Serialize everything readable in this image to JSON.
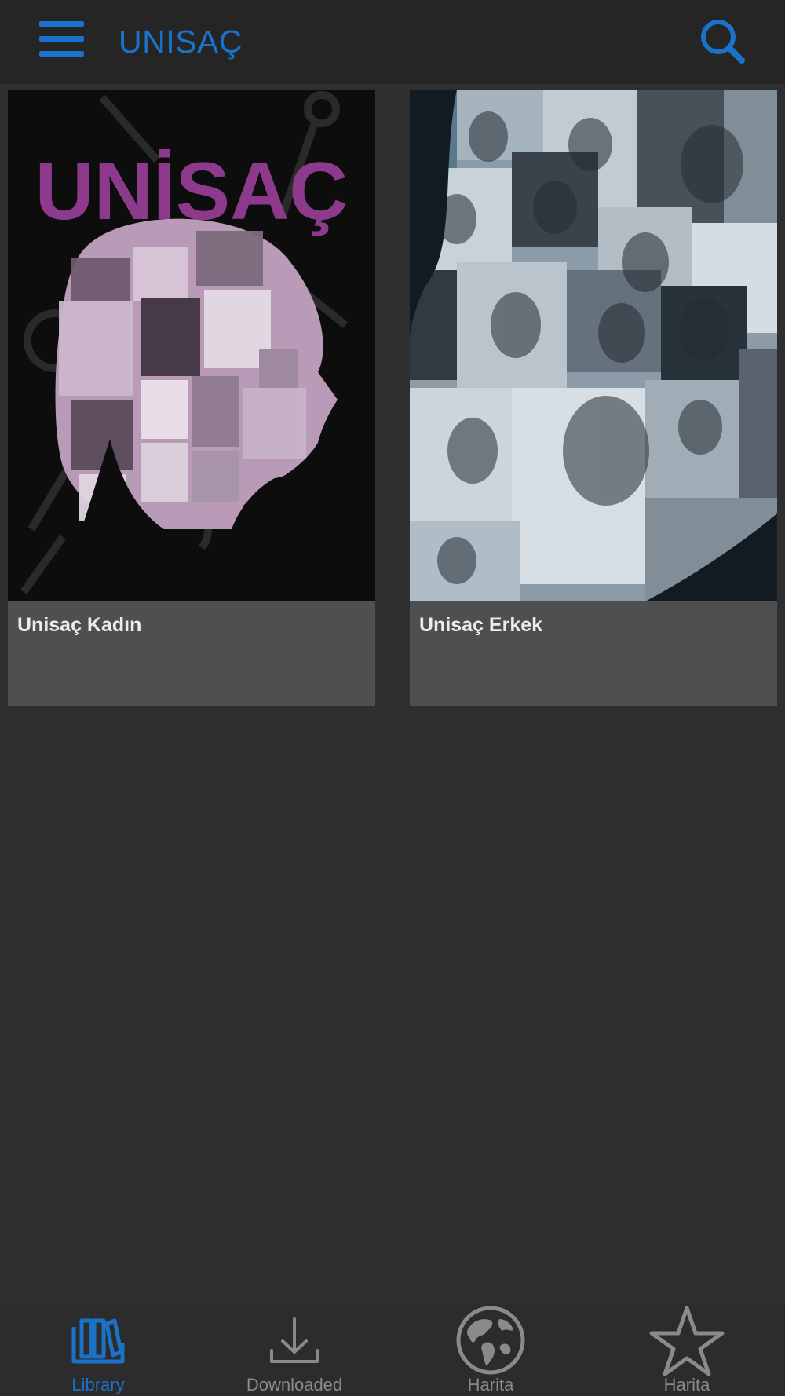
{
  "header": {
    "title": "UNISAÇ",
    "menu_icon": "hamburger-menu-icon",
    "search_icon": "search-icon"
  },
  "books": [
    {
      "title": "Unisaç Kadın",
      "cover_text": "UNİSAÇ",
      "cover_style": "black background, purple title, female silhouette filled with women's hairstyle photo collage"
    },
    {
      "title": "Unisaç Erkek",
      "cover_style": "collage of men's portrait photos in grayscale with blue tint"
    }
  ],
  "bottom_nav": [
    {
      "label": "Library",
      "icon": "library-books-icon",
      "active": true
    },
    {
      "label": "Downloaded",
      "icon": "download-icon",
      "active": false
    },
    {
      "label": "Harita",
      "icon": "globe-icon",
      "active": false
    },
    {
      "label": "Harita",
      "icon": "star-icon",
      "active": false
    }
  ],
  "colors": {
    "accent": "#1a73c8",
    "header_bg": "#252525",
    "page_bg": "#2f2f2f",
    "card_caption_bg": "#4f4f4f",
    "cover_title_purple": "#8e3a8c"
  }
}
